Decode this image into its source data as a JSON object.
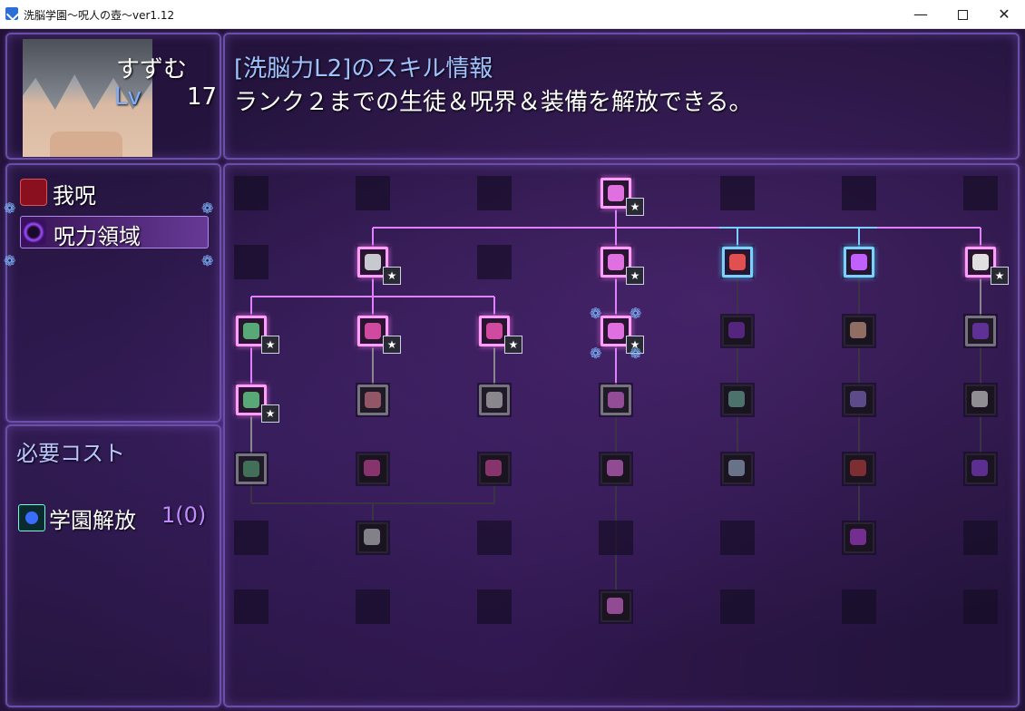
{
  "window": {
    "title": "洗脳学園～呪人の壺～ver1.12"
  },
  "character": {
    "name": "すずむ",
    "level_label": "Lv",
    "level": "17"
  },
  "skill": {
    "title": "[洗脳力L2]のスキル情報",
    "description": "ランク２までの生徒＆呪界＆装備を解放できる。"
  },
  "categories": [
    {
      "label": "我呪",
      "icon": "red-fist-icon",
      "selected": false
    },
    {
      "label": "呪力領域",
      "icon": "purple-ring-icon",
      "selected": true
    }
  ],
  "cost": {
    "title": "必要コスト",
    "item_label": "学園解放",
    "item_value": "1(0)",
    "item_icon": "blue-crest-icon"
  },
  "colors": {
    "accent": "#ff9cff",
    "blue_node": "#7ad0ff",
    "panel_border": "#6a4fa8",
    "cost_value": "#c08bff",
    "title_text": "#9fc2ff"
  },
  "skill_tree": {
    "columns": 7,
    "rows": 7,
    "nodes": [
      {
        "col": 3,
        "row": 0,
        "icon": "brain-icon",
        "state": "on",
        "star": true
      },
      {
        "col": 1,
        "row": 1,
        "icon": "orb-icon",
        "state": "on",
        "star": true
      },
      {
        "col": 3,
        "row": 1,
        "icon": "brain-icon",
        "state": "on",
        "star": true
      },
      {
        "col": 4,
        "row": 1,
        "icon": "card-icon",
        "state": "blue",
        "star": false
      },
      {
        "col": 5,
        "row": 1,
        "icon": "heart-icon",
        "state": "blue",
        "star": false
      },
      {
        "col": 6,
        "row": 1,
        "icon": "gear-icon",
        "state": "on",
        "star": true
      },
      {
        "col": 0,
        "row": 2,
        "icon": "book-icon",
        "state": "on",
        "star": true
      },
      {
        "col": 1,
        "row": 2,
        "icon": "flower-icon",
        "state": "on",
        "star": true
      },
      {
        "col": 2,
        "row": 2,
        "icon": "flower-icon",
        "state": "on",
        "star": true
      },
      {
        "col": 3,
        "row": 2,
        "icon": "brain-icon",
        "state": "on",
        "star": true,
        "selected": true
      },
      {
        "col": 4,
        "row": 2,
        "icon": "cone-icon",
        "state": "dim",
        "star": false
      },
      {
        "col": 5,
        "row": 2,
        "icon": "boot-icon",
        "state": "dim",
        "star": false
      },
      {
        "col": 6,
        "row": 2,
        "icon": "gem-icon",
        "state": "off",
        "star": false
      },
      {
        "col": 0,
        "row": 3,
        "icon": "book-icon",
        "state": "on",
        "star": true
      },
      {
        "col": 1,
        "row": 3,
        "icon": "heart-card-icon",
        "state": "off",
        "star": false
      },
      {
        "col": 2,
        "row": 3,
        "icon": "paper-icon",
        "state": "off",
        "star": false
      },
      {
        "col": 3,
        "row": 3,
        "icon": "brain-icon",
        "state": "off",
        "star": false
      },
      {
        "col": 4,
        "row": 3,
        "icon": "jar-icon",
        "state": "dim",
        "star": false
      },
      {
        "col": 5,
        "row": 3,
        "icon": "tome-icon",
        "state": "dim",
        "star": false
      },
      {
        "col": 6,
        "row": 3,
        "icon": "gear-icon",
        "state": "dim",
        "star": false
      },
      {
        "col": 0,
        "row": 4,
        "icon": "book-icon",
        "state": "off",
        "star": false
      },
      {
        "col": 1,
        "row": 4,
        "icon": "flower-icon",
        "state": "dim",
        "star": false
      },
      {
        "col": 2,
        "row": 4,
        "icon": "flower-icon",
        "state": "dim",
        "star": false
      },
      {
        "col": 3,
        "row": 4,
        "icon": "brain-icon",
        "state": "dim",
        "star": false
      },
      {
        "col": 4,
        "row": 4,
        "icon": "sword-icon",
        "state": "dim",
        "star": false
      },
      {
        "col": 5,
        "row": 4,
        "icon": "red-tome-icon",
        "state": "dim",
        "star": false
      },
      {
        "col": 6,
        "row": 4,
        "icon": "gem-icon",
        "state": "dim",
        "star": false
      },
      {
        "col": 1,
        "row": 5,
        "icon": "orb-icon",
        "state": "dim",
        "star": false
      },
      {
        "col": 5,
        "row": 5,
        "icon": "ring-icon",
        "state": "dim",
        "star": false
      },
      {
        "col": 3,
        "row": 6,
        "icon": "brain-icon",
        "state": "dim",
        "star": false
      }
    ]
  }
}
